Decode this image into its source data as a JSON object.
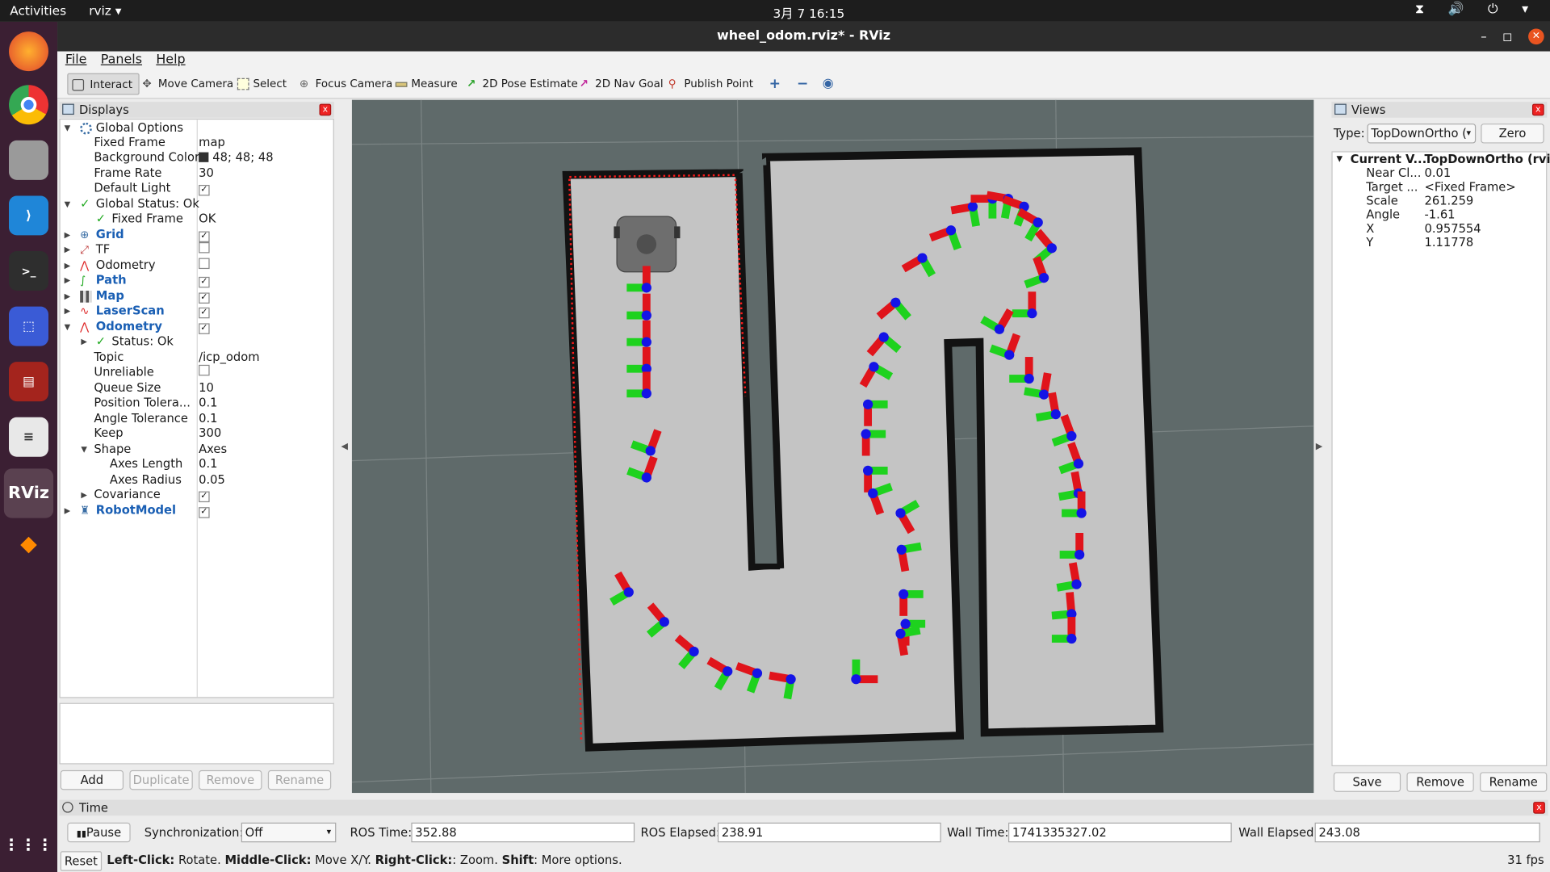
{
  "system_bar": {
    "activities": "Activities",
    "app_name": "rviz ▾",
    "clock": "3月 7  16:15",
    "tray": "⧗ 🔊 ⏻ ▾"
  },
  "dock": {
    "items": [
      "firefox",
      "chrome",
      "files",
      "vscode",
      "terminal",
      "screenshot",
      "app-red",
      "text-editor",
      "rviz",
      "sublime"
    ],
    "rviz_label": "RViz"
  },
  "window": {
    "title": "wheel_odom.rviz* - RViz",
    "min": "–",
    "max": "◻",
    "close": "✕"
  },
  "menu": [
    "File",
    "Panels",
    "Help"
  ],
  "toolbar": {
    "tools": [
      "Interact",
      "Move Camera",
      "Select",
      "Focus Camera",
      "Measure",
      "2D Pose Estimate",
      "2D Nav Goal",
      "Publish Point"
    ],
    "extra": [
      "+",
      "−",
      "◉"
    ]
  },
  "displays": {
    "title": "Displays",
    "rows": [
      {
        "label": "Global Options",
        "value": ""
      },
      {
        "label": "Fixed Frame",
        "value": "map"
      },
      {
        "label": "Background Color",
        "value": "48; 48; 48"
      },
      {
        "label": "Frame Rate",
        "value": "30"
      },
      {
        "label": "Default Light",
        "value": "✓"
      },
      {
        "label": "Global Status: Ok",
        "value": ""
      },
      {
        "label": "Fixed Frame",
        "value": "OK"
      },
      {
        "label": "Grid",
        "value": "✓"
      },
      {
        "label": "TF",
        "value": ""
      },
      {
        "label": "Odometry",
        "value": ""
      },
      {
        "label": "Path",
        "value": "✓"
      },
      {
        "label": "Map",
        "value": "✓"
      },
      {
        "label": "LaserScan",
        "value": "✓"
      },
      {
        "label": "Odometry",
        "value": "✓"
      },
      {
        "label": "Status: Ok",
        "value": ""
      },
      {
        "label": "Topic",
        "value": "/icp_odom"
      },
      {
        "label": "Unreliable",
        "value": ""
      },
      {
        "label": "Queue Size",
        "value": "10"
      },
      {
        "label": "Position Tolera...",
        "value": "0.1"
      },
      {
        "label": "Angle Tolerance",
        "value": "0.1"
      },
      {
        "label": "Keep",
        "value": "300"
      },
      {
        "label": "Shape",
        "value": "Axes"
      },
      {
        "label": "Axes Length",
        "value": "0.1"
      },
      {
        "label": "Axes Radius",
        "value": "0.05"
      },
      {
        "label": "Covariance",
        "value": "✓"
      },
      {
        "label": "RobotModel",
        "value": "✓"
      }
    ],
    "buttons": [
      "Add",
      "Duplicate",
      "Remove",
      "Rename"
    ]
  },
  "views": {
    "title": "Views",
    "type_label": "Type:",
    "type_value": "TopDownOrtho (",
    "zero": "Zero",
    "rows": [
      {
        "label": "Current V...",
        "value": "TopDownOrtho (rviz)"
      },
      {
        "label": "Near Cl...",
        "value": "0.01"
      },
      {
        "label": "Target ...",
        "value": "<Fixed Frame>"
      },
      {
        "label": "Scale",
        "value": "261.259"
      },
      {
        "label": "Angle",
        "value": "-1.61"
      },
      {
        "label": "X",
        "value": "0.957554"
      },
      {
        "label": "Y",
        "value": "1.11778"
      }
    ],
    "buttons": [
      "Save",
      "Remove",
      "Rename"
    ]
  },
  "time": {
    "title": "Time",
    "pause": "Pause",
    "sync_label": "Synchronization:",
    "sync_value": "Off",
    "ros_time_label": "ROS Time:",
    "ros_time": "352.88",
    "ros_elapsed_label": "ROS Elapsed:",
    "ros_elapsed": "238.91",
    "wall_time_label": "Wall Time:",
    "wall_time": "1741335327.02",
    "wall_elapsed_label": "Wall Elapsed:",
    "wall_elapsed": "243.08"
  },
  "status": {
    "reset": "Reset",
    "k1": "Left-Click:",
    "t1": " Rotate. ",
    "k2": "Middle-Click:",
    "t2": " Move X/Y. ",
    "k3": "Right-Click:",
    "t3": ": Zoom. ",
    "k4": "Shift",
    "t4": ": More options.",
    "fps": "31 fps"
  },
  "colors": {
    "viewport_bg": "#5f6a6a",
    "map_free": "#c8c8c8",
    "wall": "#111111",
    "axis_x": "#e0141b",
    "axis_y": "#1ed21e",
    "axis_z": "#1414e6",
    "scan": "#ff0000"
  }
}
